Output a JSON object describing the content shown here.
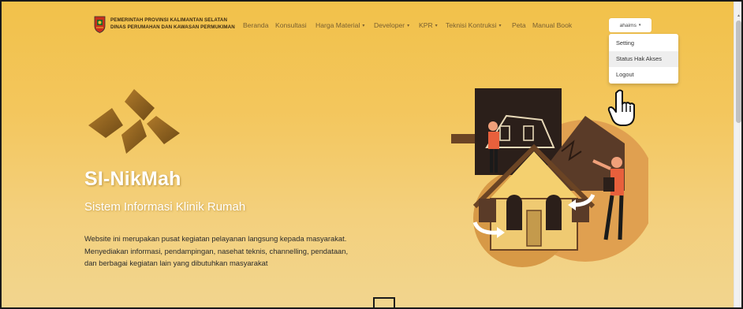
{
  "header": {
    "org_line1": "PEMERINTAH PROVINSI KALIMANTAN SELATAN",
    "org_line2": "DINAS PERUMAHAN DAN KAWASAN PERMUKIMAN",
    "logo_icon": "provincial-crest-icon"
  },
  "nav": {
    "items": [
      {
        "label": "Beranda"
      },
      {
        "label": "Konsultasi"
      },
      {
        "label": "Harga Material",
        "caret": "▾"
      },
      {
        "label": "Developer",
        "caret": "▾"
      },
      {
        "label": "KPR",
        "caret": "▾"
      },
      {
        "label": "Teknisi Kontruksi",
        "caret": "▾"
      },
      {
        "label": "Peta"
      },
      {
        "label": "Manual Book"
      }
    ]
  },
  "user_menu": {
    "username": "ahaims",
    "caret": "▾",
    "items": [
      {
        "label": "Setting"
      },
      {
        "label": "Status Hak Akses"
      },
      {
        "label": "Logout"
      }
    ]
  },
  "hero": {
    "title": "SI-NikMah",
    "subtitle": "Sistem Informasi Klinik Rumah",
    "description": [
      "Website ini merupakan pusat kegiatan pelayanan langsung kepada masyarakat.",
      "Menyediakan informasi, pendampingan, nasehat teknis, channelling, pendataan,",
      "dan berbagai kegiatan lain yang dibutuhkan masyarakat"
    ],
    "illustration_icon": "house-repair-illustration",
    "brand_icon": "sinikmah-diamond-logo-icon"
  },
  "colors": {
    "bg_top": "#f2c14a",
    "bg_bottom": "#f2d58e",
    "nav_text": "#7a6030",
    "accent_dark": "#8a5a1c"
  },
  "scrollbar": {
    "up_arrow": "▲"
  }
}
